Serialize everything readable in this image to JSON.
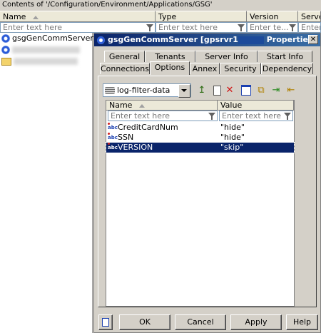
{
  "explorer": {
    "path": "Contents of '/Configuration/Environment/Applications/GSG'",
    "columns": [
      "Name",
      "Type",
      "Version",
      "Server"
    ],
    "filters": [
      "Enter text here",
      "Enter text here",
      "Enter te...",
      "Enter t"
    ],
    "items": [
      {
        "label": "gsgGenCommServer",
        "icon": "gear-icon"
      },
      {
        "label": "",
        "icon": "gear-icon"
      },
      {
        "label": "",
        "icon": "folder-icon"
      }
    ]
  },
  "dialog": {
    "title_prefix": "gsgGenCommServer [gpsrvr1",
    "title_suffix": "Properties",
    "tabs_row1": [
      "General",
      "Tenants",
      "Server Info",
      "Start Info"
    ],
    "tabs_row2": [
      "Connections",
      "Options",
      "Annex",
      "Security",
      "Dependency"
    ],
    "active_tab": "Options",
    "section_selected": "log-filter-data",
    "grid": {
      "headers": [
        "Name",
        "Value"
      ],
      "filters": [
        "Enter text here",
        "Enter text here"
      ],
      "rows": [
        {
          "name": "CreditCardNum",
          "value": "\"hide\""
        },
        {
          "name": "SSN",
          "value": "\"hide\""
        },
        {
          "name": "VERSION",
          "value": "\"skip\"",
          "selected": true
        }
      ]
    },
    "buttons": {
      "ok": "OK",
      "cancel": "Cancel",
      "apply": "Apply",
      "help": "Help"
    },
    "close_glyph": "✕",
    "abc_glyph": "abc",
    "colors": {
      "title_bar": "#0a246a",
      "selection": "#0a246a",
      "face": "#d4d0c8"
    }
  }
}
